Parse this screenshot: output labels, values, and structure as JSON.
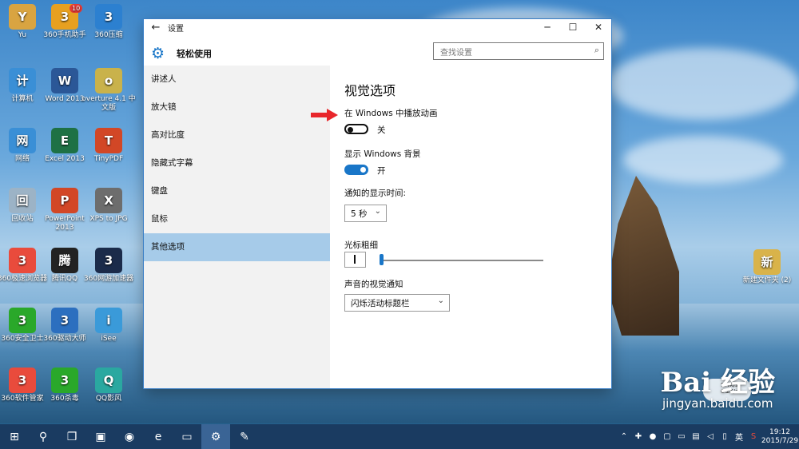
{
  "desktop": {
    "icons": [
      {
        "label": "Yu",
        "icon": "user-folder-icon",
        "color": "#d9a441"
      },
      {
        "label": "360手机助手",
        "icon": "phone-assistant-icon",
        "color": "#e7a020",
        "badge": "10"
      },
      {
        "label": "360压缩",
        "icon": "archive-icon",
        "color": "#2c80d0"
      },
      {
        "label": "计算机",
        "icon": "computer-icon",
        "color": "#3a8fd6"
      },
      {
        "label": "Word 2013",
        "icon": "word-icon",
        "color": "#2b5797"
      },
      {
        "label": "overture 4.1 中文版",
        "icon": "overture-icon",
        "color": "#c9b24b"
      },
      {
        "label": "网络",
        "icon": "network-icon",
        "color": "#3a8fd6"
      },
      {
        "label": "Excel 2013",
        "icon": "excel-icon",
        "color": "#1e7145"
      },
      {
        "label": "TinyPDF",
        "icon": "pdf-icon",
        "color": "#d24726"
      },
      {
        "label": "回收站",
        "icon": "recycle-bin-icon",
        "color": "#9cb3c6"
      },
      {
        "label": "PowerPoint 2013",
        "icon": "powerpoint-icon",
        "color": "#d24726"
      },
      {
        "label": "XPS to JPG",
        "icon": "xps-icon",
        "color": "#6d6d6d"
      },
      {
        "label": "360极速浏览器",
        "icon": "browser-icon",
        "color": "#e94b3c"
      },
      {
        "label": "腾讯QQ",
        "icon": "qq-icon",
        "color": "#222222"
      },
      {
        "label": "360网游加速器",
        "icon": "accelerator-icon",
        "color": "#1b2b4a"
      },
      {
        "label": "360安全卫士",
        "icon": "shield-plus-icon",
        "color": "#2aa82a"
      },
      {
        "label": "360驱动大师",
        "icon": "driver-icon",
        "color": "#2c6fbf"
      },
      {
        "label": "iSee",
        "icon": "isee-icon",
        "color": "#3a9ad9"
      },
      {
        "label": "360软件管家",
        "icon": "software-manager-icon",
        "color": "#e94b3c"
      },
      {
        "label": "360杀毒",
        "icon": "antivirus-icon",
        "color": "#2aa82a"
      },
      {
        "label": "QQ影风",
        "icon": "video-player-icon",
        "color": "#2aa8a0"
      },
      {
        "label": "新建文件夹 (2)",
        "icon": "folder-icon",
        "color": "#d9b34a"
      }
    ]
  },
  "window": {
    "title": "设置",
    "app_name": "轻松使用",
    "search_placeholder": "查找设置",
    "nav": [
      {
        "label": "讲述人",
        "active": false
      },
      {
        "label": "放大镜",
        "active": false
      },
      {
        "label": "高对比度",
        "active": false
      },
      {
        "label": "隐藏式字幕",
        "active": false
      },
      {
        "label": "键盘",
        "active": false
      },
      {
        "label": "鼠标",
        "active": false
      },
      {
        "label": "其他选项",
        "active": true
      }
    ],
    "content": {
      "heading": "视觉选项",
      "animations_label": "在 Windows 中播放动画",
      "animations_state": "关",
      "background_label": "显示 Windows 背景",
      "background_state": "开",
      "notify_label": "通知的显示时间:",
      "notify_value": "5 秒",
      "cursor_label": "光标粗细",
      "cursor_thickness": 1,
      "sound_label": "声音的视觉通知",
      "sound_value": "闪烁活动标题栏"
    },
    "accent_color": "#1976c8"
  },
  "taskbar": {
    "clock_time": "19:12",
    "clock_date": "2015/7/29",
    "ime": "英"
  },
  "watermark": {
    "brand": "Bai 经验",
    "site": "jingyan.baidu.com"
  },
  "netmeter": {
    "up": "9.4K/s",
    "down": "0.2K/s"
  }
}
